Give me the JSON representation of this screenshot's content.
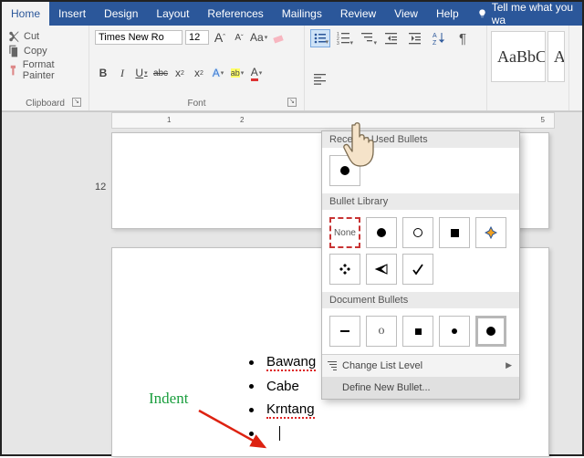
{
  "tabs": [
    "Home",
    "Insert",
    "Design",
    "Layout",
    "References",
    "Mailings",
    "Review",
    "View",
    "Help"
  ],
  "tell_me": "Tell me what you wa",
  "clipboard": {
    "cut": "Cut",
    "copy": "Copy",
    "painter": "Format Painter",
    "label": "Clipboard"
  },
  "font": {
    "family": "Times New Ro",
    "size": "12",
    "label": "Font",
    "grow": "A",
    "shrink": "A",
    "caseBtn": "Aa",
    "clear": "A",
    "bold": "B",
    "italic": "I",
    "underline": "U",
    "strike": "abc",
    "sub": "x",
    "sup": "x",
    "effects": "A",
    "highlight": "ab",
    "color": "A"
  },
  "paragraph": {
    "label": ""
  },
  "styles": {
    "sample": "AaBbCcI",
    "sample2": "Aa"
  },
  "bullets_panel": {
    "recent": "Recently Used Bullets",
    "library": "Bullet Library",
    "none": "None",
    "doc": "Document Bullets",
    "change": "Change List Level",
    "define": "Define New Bullet..."
  },
  "ruler": {
    "t1": "1",
    "t2": "2",
    "t5": "5"
  },
  "page_num": "12",
  "list": {
    "i1": "Bawang",
    "i2": "Cabe",
    "i3": "Krntang"
  },
  "annot": {
    "indent": "Indent"
  }
}
